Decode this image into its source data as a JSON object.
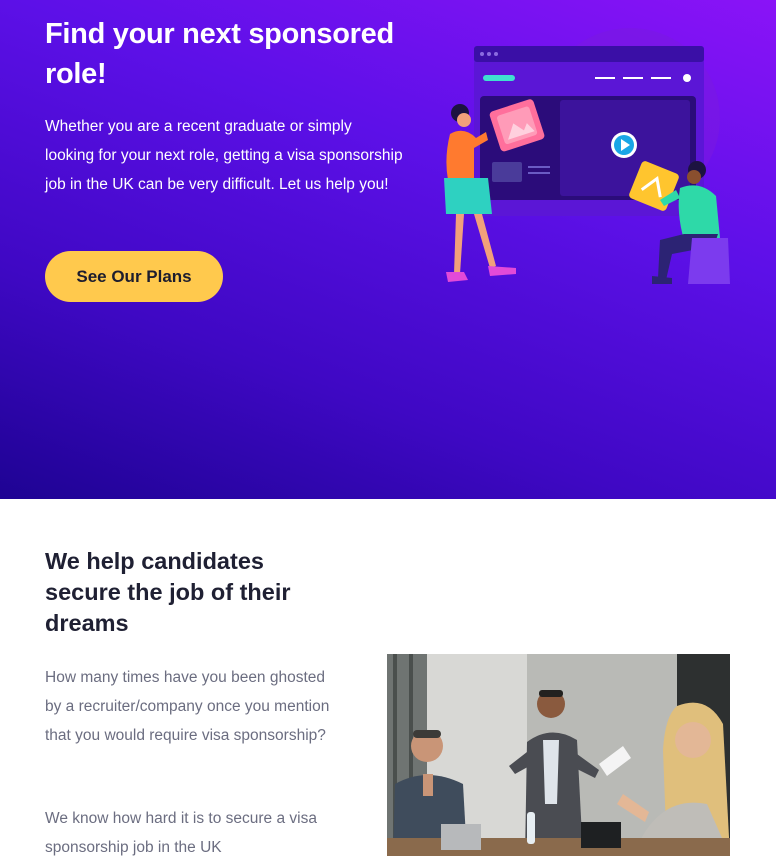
{
  "hero": {
    "title": "Find your next sponsored role!",
    "text": "Whether you are a recent graduate or simply looking for your next role, getting a visa sponsorship job in the UK can be very difficult. Let us help you!",
    "cta_label": "See Our Plans",
    "gradient_colors": [
      "#8a13f7",
      "#5d10e8",
      "#1e0393"
    ],
    "cta_color": "#ffc94d"
  },
  "section": {
    "title": "We help candidates secure the job of their dreams",
    "paragraph_1": "How many times have you been ghosted by a recruiter/company once you mention that you would require visa sponsorship?",
    "paragraph_2": "We know how hard it is to secure a visa sponsorship job in the UK"
  },
  "illustration": {
    "icon": "people-collaborating-illustration"
  },
  "photo": {
    "icon": "meeting-photo"
  }
}
